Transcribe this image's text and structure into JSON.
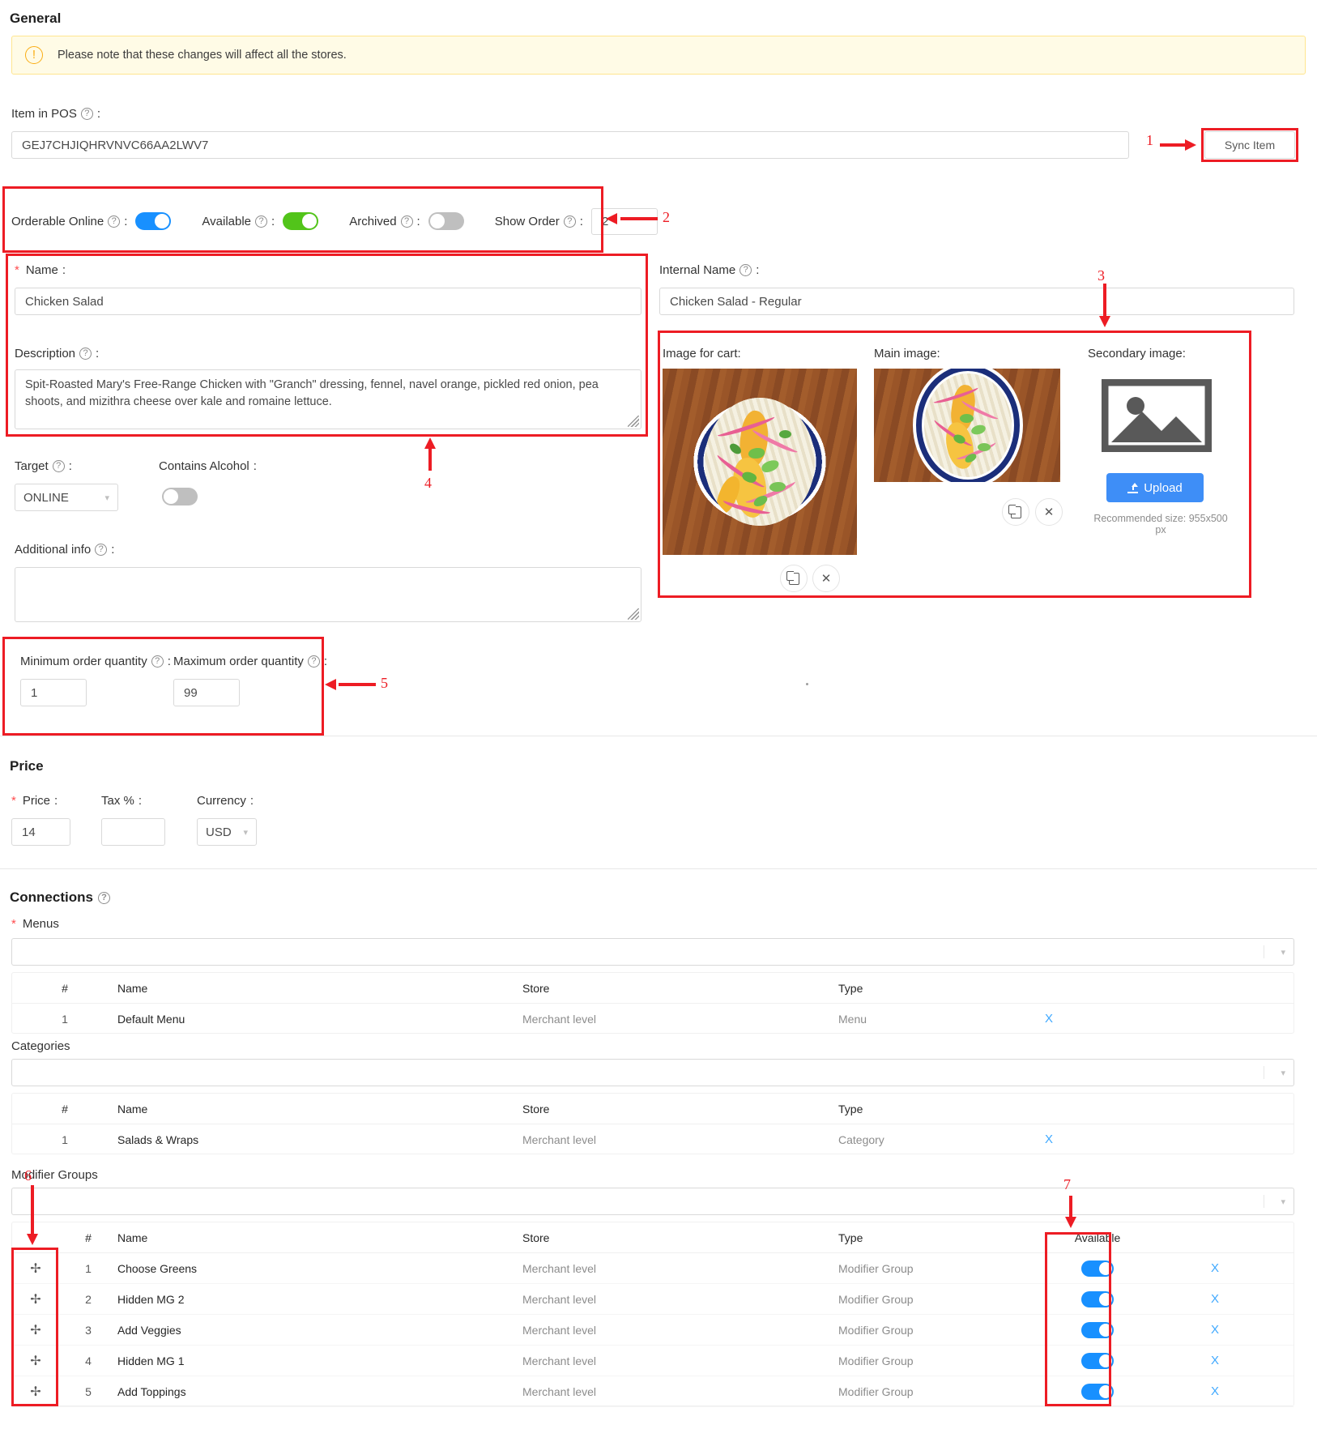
{
  "sections": {
    "general": "General",
    "price": "Price",
    "connections": "Connections"
  },
  "alert": {
    "icon": "warning-circle-icon",
    "text": "Please note that these changes will affect all the stores."
  },
  "item_in_pos": {
    "label": "Item in POS",
    "value": "GEJ7CHJIQHRVNVC66AA2LWV7",
    "sync_button": "Sync Item"
  },
  "toggles": {
    "orderable_online": {
      "label": "Orderable Online",
      "state": "on",
      "color": "#1890ff"
    },
    "available": {
      "label": "Available",
      "state": "on",
      "color": "#52c41a"
    },
    "archived": {
      "label": "Archived",
      "state": "off",
      "color": "#bfbfbf"
    },
    "show_order": {
      "label": "Show Order",
      "value": "2"
    }
  },
  "name_field": {
    "label": "Name",
    "required": true,
    "value": "Chicken Salad"
  },
  "description_field": {
    "label": "Description",
    "value": "Spit-Roasted Mary's Free-Range Chicken with \"Granch\" dressing, fennel, navel orange, pickled red onion, pea shoots, and mizithra cheese over kale and romaine lettuce."
  },
  "internal_name_field": {
    "label": "Internal Name",
    "value": "Chicken Salad - Regular"
  },
  "target_field": {
    "label": "Target",
    "value": "ONLINE"
  },
  "contains_alcohol": {
    "label": "Contains Alcohol",
    "state": "off"
  },
  "additional_info": {
    "label": "Additional info",
    "value": ""
  },
  "quantity": {
    "min": {
      "label": "Minimum order quantity",
      "value": "1"
    },
    "max": {
      "label": "Maximum order quantity",
      "value": "99"
    }
  },
  "images": {
    "cart": {
      "label": "Image for cart:",
      "has_image": true,
      "copy_icon": "copy-icon",
      "delete_icon": "close-icon"
    },
    "main": {
      "label": "Main image:",
      "has_image": true,
      "copy_icon": "copy-icon",
      "delete_icon": "close-icon"
    },
    "secondary": {
      "label": "Secondary image:",
      "has_image": false,
      "placeholder_icon": "image-placeholder-icon",
      "upload_button": "Upload",
      "upload_icon": "upload-icon",
      "hint": "Recommended size: 955x500 px"
    }
  },
  "price_section": {
    "price": {
      "label": "Price",
      "required": true,
      "value": "14"
    },
    "tax": {
      "label": "Tax %",
      "value": ""
    },
    "currency": {
      "label": "Currency",
      "value": "USD"
    }
  },
  "connections": {
    "menus": {
      "label": "Menus",
      "required": true,
      "select_value": "",
      "columns": [
        "#",
        "Name",
        "Store",
        "Type"
      ],
      "rows": [
        {
          "num": "1",
          "name": "Default Menu",
          "store": "Merchant level",
          "type": "Menu",
          "remove": "X"
        }
      ]
    },
    "categories": {
      "label": "Categories",
      "select_value": "",
      "columns": [
        "#",
        "Name",
        "Store",
        "Type"
      ],
      "rows": [
        {
          "num": "1",
          "name": "Salads & Wraps",
          "store": "Merchant level",
          "type": "Category",
          "remove": "X"
        }
      ]
    },
    "modifier_groups": {
      "label": "Modifier Groups",
      "select_value": "",
      "columns": [
        "#",
        "Name",
        "Store",
        "Type",
        "Available"
      ],
      "rows": [
        {
          "num": "1",
          "name": "Choose Greens",
          "store": "Merchant level",
          "type": "Modifier Group",
          "available": "on",
          "remove": "X"
        },
        {
          "num": "2",
          "name": "Hidden MG 2",
          "store": "Merchant level",
          "type": "Modifier Group",
          "available": "on",
          "remove": "X"
        },
        {
          "num": "3",
          "name": "Add Veggies",
          "store": "Merchant level",
          "type": "Modifier Group",
          "available": "on",
          "remove": "X"
        },
        {
          "num": "4",
          "name": "Hidden MG 1",
          "store": "Merchant level",
          "type": "Modifier Group",
          "available": "on",
          "remove": "X"
        },
        {
          "num": "5",
          "name": "Add Toppings",
          "store": "Merchant level",
          "type": "Modifier Group",
          "available": "on",
          "remove": "X"
        }
      ]
    }
  },
  "annotations": {
    "a1": "1",
    "a2": "2",
    "a3": "3",
    "a4": "4",
    "a5": "5",
    "a6": "6",
    "a7": "7",
    "color": "#ed1c24"
  }
}
